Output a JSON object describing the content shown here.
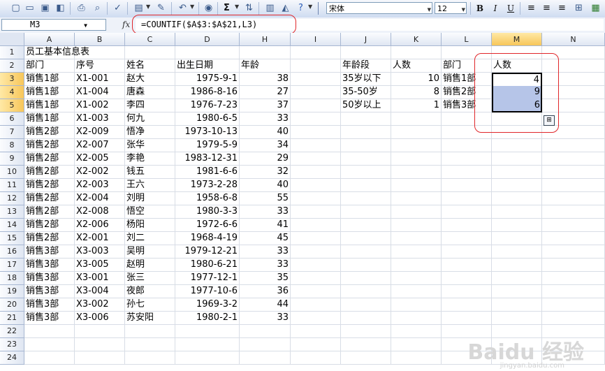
{
  "toolbar": {
    "font_name": "宋体",
    "font_size": "12",
    "bold": "B",
    "italic": "I",
    "underline": "U",
    "sum_symbol": "Σ"
  },
  "formula_bar": {
    "name_box": "M3",
    "fx_label": "fx",
    "formula": "=COUNTIF($A$3:$A$21,L3)"
  },
  "columns": [
    "A",
    "B",
    "C",
    "D",
    "H",
    "I",
    "J",
    "K",
    "L",
    "M",
    "N"
  ],
  "rows": [
    "1",
    "2",
    "3",
    "4",
    "5",
    "6",
    "7",
    "8",
    "9",
    "10",
    "11",
    "12",
    "13",
    "14",
    "15",
    "16",
    "17",
    "18",
    "19",
    "20",
    "21",
    "22",
    "23",
    "24"
  ],
  "sheet_title": "员工基本信息表",
  "headers": {
    "dept": "部门",
    "id": "序号",
    "name": "姓名",
    "birth": "出生日期",
    "age": "年龄"
  },
  "employees": [
    {
      "dept": "销售1部",
      "id": "X1-001",
      "name": "赵大",
      "birth": "1975-9-1",
      "age": "38"
    },
    {
      "dept": "销售1部",
      "id": "X1-004",
      "name": "唐森",
      "birth": "1986-8-16",
      "age": "27"
    },
    {
      "dept": "销售1部",
      "id": "X1-002",
      "name": "李四",
      "birth": "1976-7-23",
      "age": "37"
    },
    {
      "dept": "销售1部",
      "id": "X1-003",
      "name": "何九",
      "birth": "1980-6-5",
      "age": "33"
    },
    {
      "dept": "销售2部",
      "id": "X2-009",
      "name": "悟净",
      "birth": "1973-10-13",
      "age": "40"
    },
    {
      "dept": "销售2部",
      "id": "X2-007",
      "name": "张华",
      "birth": "1979-5-9",
      "age": "34"
    },
    {
      "dept": "销售2部",
      "id": "X2-005",
      "name": "李艳",
      "birth": "1983-12-31",
      "age": "29"
    },
    {
      "dept": "销售2部",
      "id": "X2-002",
      "name": "钱五",
      "birth": "1981-6-6",
      "age": "32"
    },
    {
      "dept": "销售2部",
      "id": "X2-003",
      "name": "王六",
      "birth": "1973-2-28",
      "age": "40"
    },
    {
      "dept": "销售2部",
      "id": "X2-004",
      "name": "刘明",
      "birth": "1958-6-8",
      "age": "55"
    },
    {
      "dept": "销售2部",
      "id": "X2-008",
      "name": "悟空",
      "birth": "1980-3-3",
      "age": "33"
    },
    {
      "dept": "销售2部",
      "id": "X2-006",
      "name": "杨阳",
      "birth": "1972-6-6",
      "age": "41"
    },
    {
      "dept": "销售2部",
      "id": "X2-001",
      "name": "刘二",
      "birth": "1968-4-19",
      "age": "45"
    },
    {
      "dept": "销售3部",
      "id": "X3-003",
      "name": "吴明",
      "birth": "1979-12-21",
      "age": "33"
    },
    {
      "dept": "销售3部",
      "id": "X3-005",
      "name": "赵明",
      "birth": "1980-6-21",
      "age": "33"
    },
    {
      "dept": "销售3部",
      "id": "X3-001",
      "name": "张三",
      "birth": "1977-12-1",
      "age": "35"
    },
    {
      "dept": "销售3部",
      "id": "X3-004",
      "name": "夜郎",
      "birth": "1977-10-6",
      "age": "36"
    },
    {
      "dept": "销售3部",
      "id": "X3-002",
      "name": "孙七",
      "birth": "1969-3-2",
      "age": "44"
    },
    {
      "dept": "销售3部",
      "id": "X3-006",
      "name": "苏安阳",
      "birth": "1980-2-1",
      "age": "33"
    }
  ],
  "age_summary": {
    "header_group": "年龄段",
    "header_count": "人数",
    "items": [
      {
        "label": "35岁以下",
        "count": "10"
      },
      {
        "label": "35-50岁",
        "count": "8"
      },
      {
        "label": "50岁以上",
        "count": "1"
      }
    ]
  },
  "dept_summary": {
    "header_dept": "部门",
    "header_count": "人数",
    "items": [
      {
        "dept": "销售1部",
        "count": "4"
      },
      {
        "dept": "销售2部",
        "count": "9"
      },
      {
        "dept": "销售3部",
        "count": "6"
      }
    ]
  },
  "watermark": {
    "main": "Baidu 经验",
    "sub": "jingyan.baidu.com"
  }
}
